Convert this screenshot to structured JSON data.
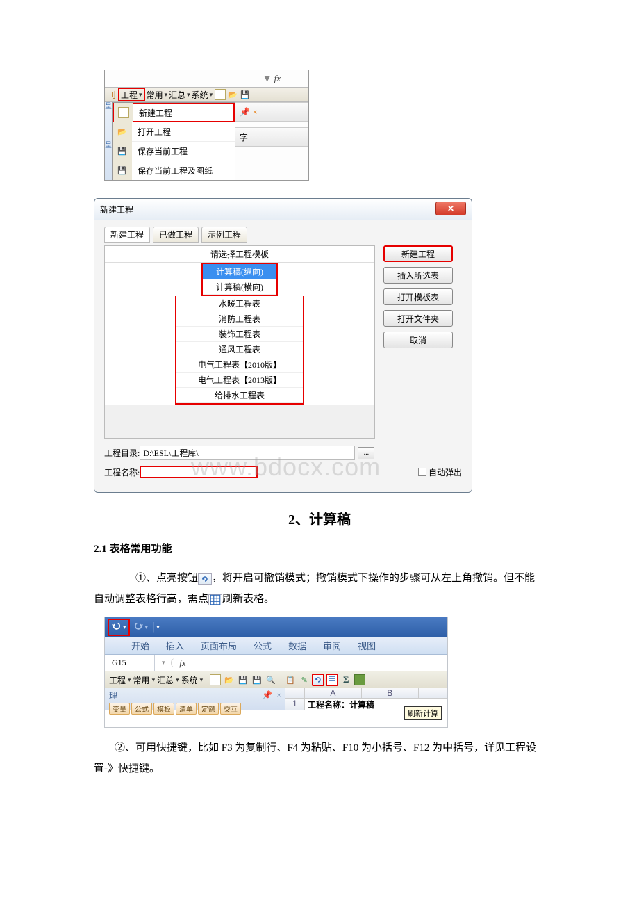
{
  "ss1": {
    "fx": "fx",
    "menus": [
      "工程",
      "常用",
      "汇总",
      "系统"
    ],
    "dropdown": [
      {
        "label": "新建工程",
        "icon": "newfile",
        "hl": true
      },
      {
        "label": "打开工程",
        "icon": "openfile",
        "hl": false
      },
      {
        "label": "保存当前工程",
        "icon": "diskette",
        "hl": false
      },
      {
        "label": "保存当前工程及图纸",
        "icon": "savecfg",
        "hl": false
      }
    ],
    "rightstub": "字"
  },
  "dlg": {
    "title": "新建工程",
    "tabs": [
      "新建工程",
      "已做工程",
      "示例工程"
    ],
    "tpl_header": "请选择工程模板",
    "tpl_group1": [
      "计算稿(纵向)",
      "计算稿(横向)"
    ],
    "tpl_group2": [
      "水暖工程表",
      "消防工程表",
      "装饰工程表",
      "通风工程表",
      "电气工程表【2010版】",
      "电气工程表【2013版】",
      "给排水工程表"
    ],
    "buttons": [
      "新建工程",
      "插入所选表",
      "打开模板表",
      "打开文件夹",
      "取消"
    ],
    "dir_label": "工程目录:",
    "dir_value": "D:\\ESL\\工程库\\",
    "name_label": "工程名称:",
    "auto_popup": "自动弹出",
    "watermark": "www.bdocx.com"
  },
  "sec2": {
    "title": "2、计算稿",
    "sub": "2.1 表格常用功能",
    "p1a": "①、点亮按钮",
    "p1b": "，将开启可撤销模式；撤销模式下操作的步骤可从左上角撤销。但不能自动调整表格行高，需点",
    "p1c": "刷新表格。",
    "p2": "②、可用快捷键，比如 F3 为复制行、F4 为粘贴、F10 为小括号、F12 为中括号，详见工程设置-》快捷键。"
  },
  "ss3": {
    "ribbon": [
      "开始",
      "插入",
      "页面布局",
      "公式",
      "数据",
      "审阅",
      "视图"
    ],
    "namebox": "G15",
    "fx": "fx",
    "tool_menu": [
      "工程",
      "常用",
      "汇总",
      "系统"
    ],
    "panel_label": "理",
    "tiny_tabs": [
      "变量",
      "公式",
      "模板",
      "清单",
      "定额",
      "交互"
    ],
    "cols": [
      "A",
      "B"
    ],
    "rownum": "1",
    "cell_text": "工程名称：计算稿",
    "tooltip": "刷新计算"
  }
}
